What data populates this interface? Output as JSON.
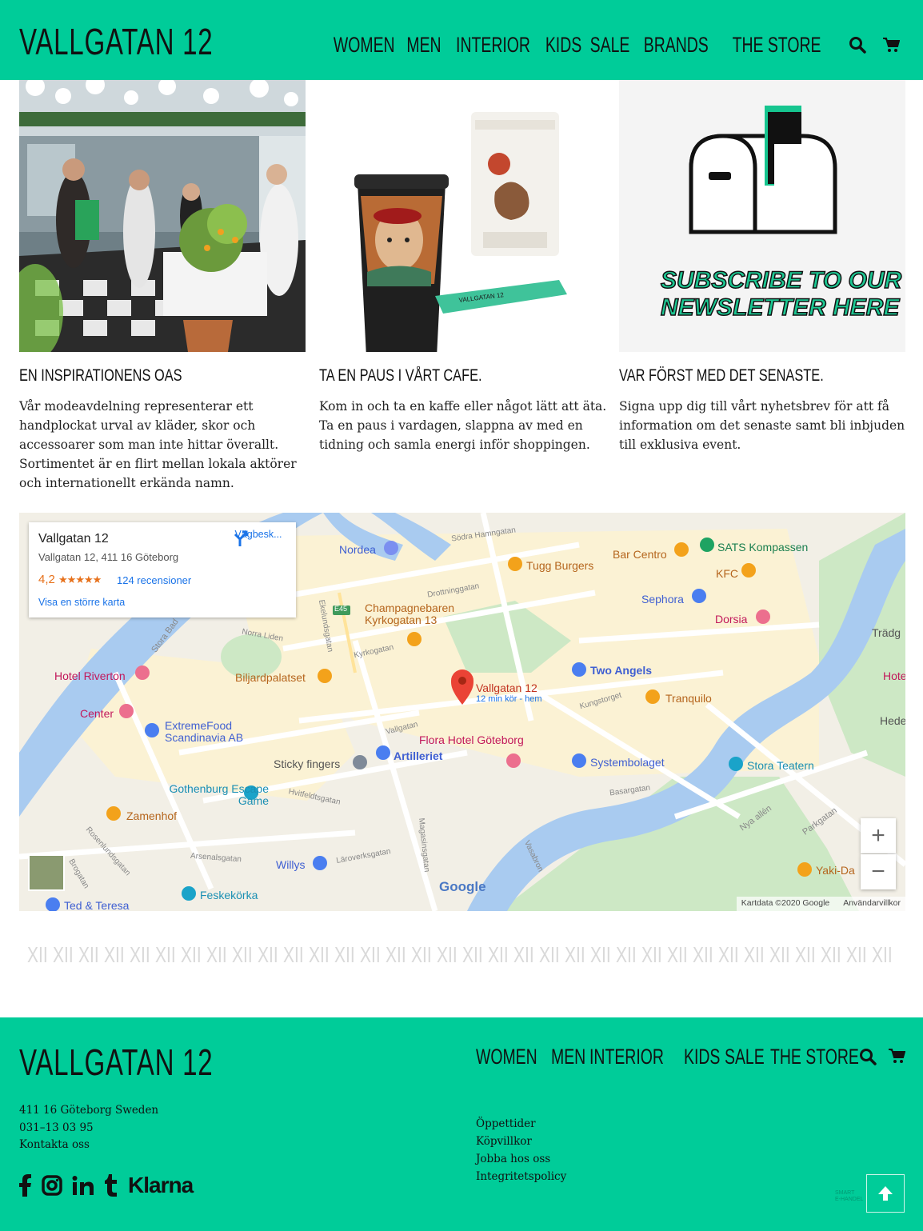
{
  "header": {
    "logo": "VALLGATAN 12",
    "nav": [
      "WOMEN",
      "MEN",
      "INTERIOR",
      "KIDS",
      "SALE",
      "BRANDS",
      "THE STORE"
    ],
    "icons": [
      "search-icon",
      "cart-icon"
    ]
  },
  "cards": [
    {
      "title": "EN INSPIRATIONENS OAS",
      "text": "Vår modeavdelning representerar ett handplockat urval av kläder, skor och accessoarer som man inte hittar överallt. Sortimentet är en flirt mellan lokala aktörer och internationellt erkända namn."
    },
    {
      "title": "TA EN PAUS I VÅRT CAFE.",
      "text": "Kom in och ta en kaffe eller något lätt att äta. Ta en paus i vardagen, slappna av med en tidning och samla energi inför shoppingen.",
      "sticker_text": "VALLGATAN 12"
    },
    {
      "title": "VAR FÖRST MED DET SENASTE.",
      "text": "Signa upp dig till vårt nyhetsbrev för att få information om det senaste samt bli inbjuden till exklusiva event.",
      "image_text": [
        "SUBSCRIBE TO OUR",
        "NEWSLETTER HERE"
      ]
    }
  ],
  "map": {
    "place_title": "Vallgatan 12",
    "place_address": "Vallgatan 12, 411 16 Göteborg",
    "rating": "4,2",
    "stars": "★★★★★",
    "reviews": "124 recensioner",
    "larger_map": "Visa en större karta",
    "directions": "Vägbesk...",
    "pin_label": "Vallgatan 12",
    "pin_sub": "12 min kör - hem",
    "attribution": "Kartdata ©2020 Google",
    "terms": "Användarvillkor",
    "google": "Google",
    "zoom_in": "+",
    "zoom_out": "−",
    "labels": [
      "Nordea",
      "Tugg Burgers",
      "Bar Centro",
      "SATS Kompassen",
      "KFC",
      "Sephora",
      "Dorsia",
      "Champagnebaren Kyrkogatan 13",
      "Hotel Riverton",
      "Biljardpalatset",
      "Two Angels",
      "Tranquilo",
      "Center",
      "ExtremeFood Scandinavia AB",
      "Flora Hotel Göteborg",
      "Sticky fingers",
      "Artilleriet",
      "Systembolaget",
      "Stora Teatern",
      "Gothenburg Escape Game",
      "Zamenhof",
      "Willys",
      "Feskekörka",
      "Ted & Teresa",
      "Yaki-Da",
      "Heden P",
      "Trädg",
      "Hote",
      "E45"
    ],
    "streets": [
      "Södra Hamngatan",
      "Drottninggatan",
      "Kyrkogatan",
      "Vallgatan",
      "Kungstorget",
      "Basargatan",
      "Hvitfeldtsgatan",
      "Arsenalsgatan",
      "Läroverksgatan",
      "Magasinsgatan",
      "Vasabron",
      "Nya allén",
      "Parkgatan",
      "Stora Bad",
      "Norra Liden",
      "Ekelundsgatan",
      "Rosenlundsgatan",
      "Brogatan"
    ]
  },
  "xii": "XII",
  "footer": {
    "logo": "VALLGATAN 12",
    "address_lines": [
      "411 16 Göteborg Sweden",
      "031–13 03 95",
      "Kontakta oss"
    ],
    "nav": [
      "WOMEN",
      "MEN",
      "INTERIOR",
      "KIDS",
      "SALE",
      "THE STORE"
    ],
    "links": [
      "Öppettider",
      "Köpvillkor",
      "Jobba hos oss",
      "Integritetspolicy"
    ],
    "social": [
      "facebook-icon",
      "instagram-icon",
      "linkedin-icon",
      "tumblr-icon"
    ],
    "klarna": "Klarna",
    "badge": [
      "SMART",
      "E-HANDEL"
    ]
  },
  "colors": {
    "accent": "#00cc99",
    "text": "#111111",
    "pin": "#ea4335"
  }
}
